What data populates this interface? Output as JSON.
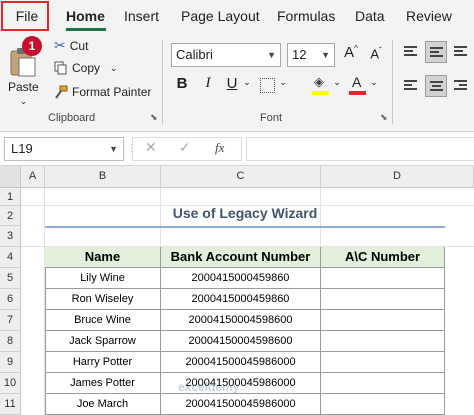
{
  "tabs": [
    {
      "label": "File"
    },
    {
      "label": "Home"
    },
    {
      "label": "Insert"
    },
    {
      "label": "Page Layout"
    },
    {
      "label": "Formulas"
    },
    {
      "label": "Data"
    },
    {
      "label": "Review"
    }
  ],
  "step_badge": "1",
  "clipboard": {
    "paste_label": "Paste",
    "cut_label": "Cut",
    "copy_label": "Copy",
    "format_painter_label": "Format Painter",
    "group_label": "Clipboard"
  },
  "font": {
    "name": "Calibri",
    "size": "12",
    "grow_label": "A",
    "shrink_label": "A",
    "group_label": "Font"
  },
  "formula_bar": {
    "name_box": "L19",
    "cancel_glyph": "✕",
    "enter_glyph": "✓",
    "fx_label": "fx",
    "content": ""
  },
  "columns": [
    "A",
    "B",
    "C",
    "D"
  ],
  "rows": [
    "1",
    "2",
    "3",
    "4",
    "5",
    "6",
    "7",
    "8",
    "9",
    "10",
    "11"
  ],
  "sheet": {
    "title": "Use of Legacy Wizard",
    "headers": [
      "Name",
      "Bank Account Number",
      "A\\C Number"
    ],
    "data": [
      [
        "Lily Wine",
        "2000415000459860",
        ""
      ],
      [
        "Ron Wiseley",
        "2000415000459860",
        ""
      ],
      [
        "Bruce Wine",
        "20004150004598600",
        ""
      ],
      [
        "Jack Sparrow",
        "20004150004598600",
        ""
      ],
      [
        "Harry Potter",
        "200041500045986000",
        ""
      ],
      [
        "James Potter",
        "200041500045986000",
        ""
      ],
      [
        "Joe March",
        "200041500045986000",
        ""
      ]
    ]
  },
  "watermark": "exceldemy",
  "colors": {
    "accent": "#217346",
    "highlight_box": "#e0262f",
    "badge": "#c8102e",
    "header_fill": "#e2efda",
    "title_text": "#44546a"
  }
}
